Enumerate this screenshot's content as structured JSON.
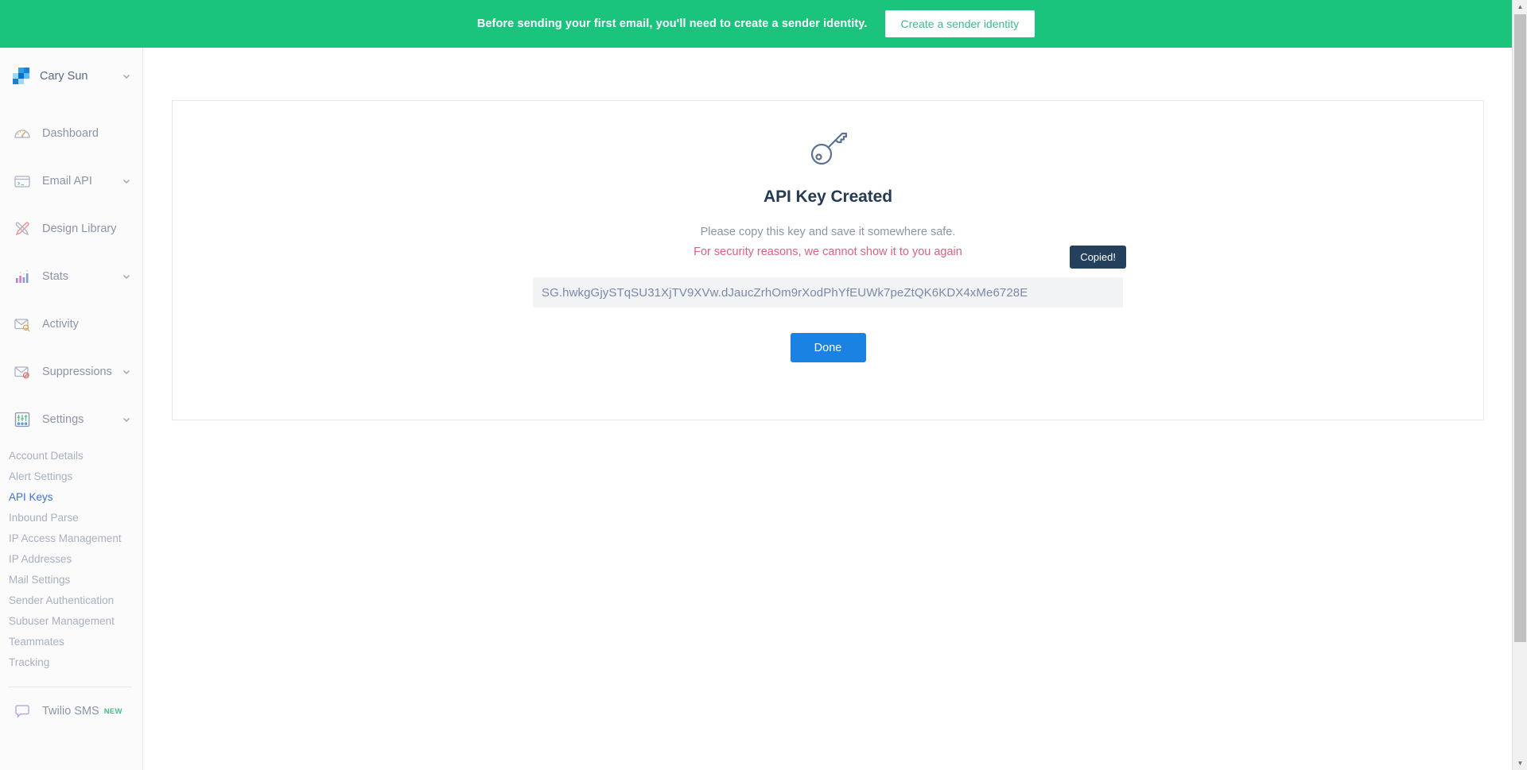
{
  "banner": {
    "message": "Before sending your first email, you'll need to create a sender identity.",
    "button_label": "Create a sender identity",
    "background_color": "#1bc47d",
    "button_text_color": "#3bbd8a"
  },
  "sidebar": {
    "account": {
      "name": "Cary Sun",
      "chevron_icon": "chevron-down-icon",
      "logo_icon": "account-logo-icon"
    },
    "items": [
      {
        "label": "Dashboard",
        "icon": "speedometer-icon",
        "has_chevron": false
      },
      {
        "label": "Email API",
        "icon": "terminal-window-icon",
        "has_chevron": true
      },
      {
        "label": "Design Library",
        "icon": "pencil-ruler-icon",
        "has_chevron": false
      },
      {
        "label": "Stats",
        "icon": "bar-chart-icon",
        "has_chevron": true
      },
      {
        "label": "Activity",
        "icon": "envelope-search-icon",
        "has_chevron": false
      },
      {
        "label": "Suppressions",
        "icon": "envelope-blocked-icon",
        "has_chevron": true
      },
      {
        "label": "Settings",
        "icon": "sliders-icon",
        "has_chevron": true
      }
    ],
    "settings_submenu": [
      {
        "label": "Account Details",
        "active": false
      },
      {
        "label": "Alert Settings",
        "active": false
      },
      {
        "label": "API Keys",
        "active": true
      },
      {
        "label": "Inbound Parse",
        "active": false
      },
      {
        "label": "IP Access Management",
        "active": false
      },
      {
        "label": "IP Addresses",
        "active": false
      },
      {
        "label": "Mail Settings",
        "active": false
      },
      {
        "label": "Sender Authentication",
        "active": false
      },
      {
        "label": "Subuser Management",
        "active": false
      },
      {
        "label": "Teammates",
        "active": false
      },
      {
        "label": "Tracking",
        "active": false
      }
    ],
    "footer": {
      "label": "Twilio SMS",
      "badge": "NEW",
      "badge_color": "#45c08a",
      "icon": "chat-bubble-icon"
    },
    "active_link_color": "#3f6fe0"
  },
  "main": {
    "key_icon": "key-icon",
    "title": "API Key Created",
    "subtitle": "Please copy this key and save it somewhere safe.",
    "warning": "For security reasons, we cannot show it to you again",
    "warning_color": "#e0607e",
    "api_key": "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",
    "copied_tooltip": "Copied!",
    "tooltip_background": "#25405c",
    "done_label": "Done",
    "done_color": "#1a82e2"
  }
}
